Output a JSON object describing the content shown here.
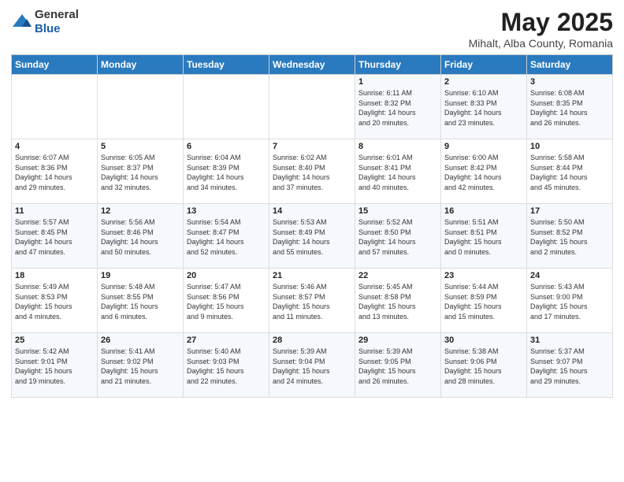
{
  "logo": {
    "general": "General",
    "blue": "Blue"
  },
  "title": {
    "month_year": "May 2025",
    "location": "Mihalt, Alba County, Romania"
  },
  "days_of_week": [
    "Sunday",
    "Monday",
    "Tuesday",
    "Wednesday",
    "Thursday",
    "Friday",
    "Saturday"
  ],
  "weeks": [
    [
      {
        "day": "",
        "info": ""
      },
      {
        "day": "",
        "info": ""
      },
      {
        "day": "",
        "info": ""
      },
      {
        "day": "",
        "info": ""
      },
      {
        "day": "1",
        "info": "Sunrise: 6:11 AM\nSunset: 8:32 PM\nDaylight: 14 hours\nand 20 minutes."
      },
      {
        "day": "2",
        "info": "Sunrise: 6:10 AM\nSunset: 8:33 PM\nDaylight: 14 hours\nand 23 minutes."
      },
      {
        "day": "3",
        "info": "Sunrise: 6:08 AM\nSunset: 8:35 PM\nDaylight: 14 hours\nand 26 minutes."
      }
    ],
    [
      {
        "day": "4",
        "info": "Sunrise: 6:07 AM\nSunset: 8:36 PM\nDaylight: 14 hours\nand 29 minutes."
      },
      {
        "day": "5",
        "info": "Sunrise: 6:05 AM\nSunset: 8:37 PM\nDaylight: 14 hours\nand 32 minutes."
      },
      {
        "day": "6",
        "info": "Sunrise: 6:04 AM\nSunset: 8:39 PM\nDaylight: 14 hours\nand 34 minutes."
      },
      {
        "day": "7",
        "info": "Sunrise: 6:02 AM\nSunset: 8:40 PM\nDaylight: 14 hours\nand 37 minutes."
      },
      {
        "day": "8",
        "info": "Sunrise: 6:01 AM\nSunset: 8:41 PM\nDaylight: 14 hours\nand 40 minutes."
      },
      {
        "day": "9",
        "info": "Sunrise: 6:00 AM\nSunset: 8:42 PM\nDaylight: 14 hours\nand 42 minutes."
      },
      {
        "day": "10",
        "info": "Sunrise: 5:58 AM\nSunset: 8:44 PM\nDaylight: 14 hours\nand 45 minutes."
      }
    ],
    [
      {
        "day": "11",
        "info": "Sunrise: 5:57 AM\nSunset: 8:45 PM\nDaylight: 14 hours\nand 47 minutes."
      },
      {
        "day": "12",
        "info": "Sunrise: 5:56 AM\nSunset: 8:46 PM\nDaylight: 14 hours\nand 50 minutes."
      },
      {
        "day": "13",
        "info": "Sunrise: 5:54 AM\nSunset: 8:47 PM\nDaylight: 14 hours\nand 52 minutes."
      },
      {
        "day": "14",
        "info": "Sunrise: 5:53 AM\nSunset: 8:49 PM\nDaylight: 14 hours\nand 55 minutes."
      },
      {
        "day": "15",
        "info": "Sunrise: 5:52 AM\nSunset: 8:50 PM\nDaylight: 14 hours\nand 57 minutes."
      },
      {
        "day": "16",
        "info": "Sunrise: 5:51 AM\nSunset: 8:51 PM\nDaylight: 15 hours\nand 0 minutes."
      },
      {
        "day": "17",
        "info": "Sunrise: 5:50 AM\nSunset: 8:52 PM\nDaylight: 15 hours\nand 2 minutes."
      }
    ],
    [
      {
        "day": "18",
        "info": "Sunrise: 5:49 AM\nSunset: 8:53 PM\nDaylight: 15 hours\nand 4 minutes."
      },
      {
        "day": "19",
        "info": "Sunrise: 5:48 AM\nSunset: 8:55 PM\nDaylight: 15 hours\nand 6 minutes."
      },
      {
        "day": "20",
        "info": "Sunrise: 5:47 AM\nSunset: 8:56 PM\nDaylight: 15 hours\nand 9 minutes."
      },
      {
        "day": "21",
        "info": "Sunrise: 5:46 AM\nSunset: 8:57 PM\nDaylight: 15 hours\nand 11 minutes."
      },
      {
        "day": "22",
        "info": "Sunrise: 5:45 AM\nSunset: 8:58 PM\nDaylight: 15 hours\nand 13 minutes."
      },
      {
        "day": "23",
        "info": "Sunrise: 5:44 AM\nSunset: 8:59 PM\nDaylight: 15 hours\nand 15 minutes."
      },
      {
        "day": "24",
        "info": "Sunrise: 5:43 AM\nSunset: 9:00 PM\nDaylight: 15 hours\nand 17 minutes."
      }
    ],
    [
      {
        "day": "25",
        "info": "Sunrise: 5:42 AM\nSunset: 9:01 PM\nDaylight: 15 hours\nand 19 minutes."
      },
      {
        "day": "26",
        "info": "Sunrise: 5:41 AM\nSunset: 9:02 PM\nDaylight: 15 hours\nand 21 minutes."
      },
      {
        "day": "27",
        "info": "Sunrise: 5:40 AM\nSunset: 9:03 PM\nDaylight: 15 hours\nand 22 minutes."
      },
      {
        "day": "28",
        "info": "Sunrise: 5:39 AM\nSunset: 9:04 PM\nDaylight: 15 hours\nand 24 minutes."
      },
      {
        "day": "29",
        "info": "Sunrise: 5:39 AM\nSunset: 9:05 PM\nDaylight: 15 hours\nand 26 minutes."
      },
      {
        "day": "30",
        "info": "Sunrise: 5:38 AM\nSunset: 9:06 PM\nDaylight: 15 hours\nand 28 minutes."
      },
      {
        "day": "31",
        "info": "Sunrise: 5:37 AM\nSunset: 9:07 PM\nDaylight: 15 hours\nand 29 minutes."
      }
    ]
  ]
}
